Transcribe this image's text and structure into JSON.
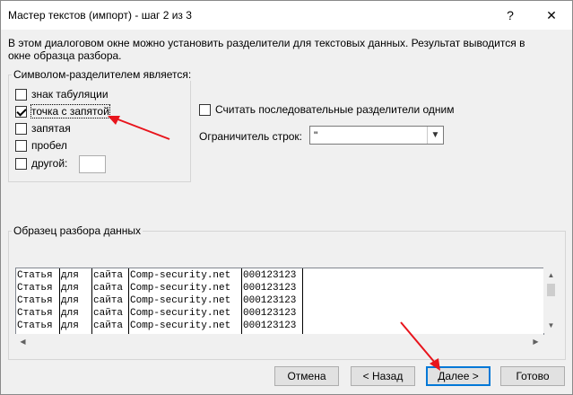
{
  "window": {
    "title": "Мастер текстов (импорт) - шаг 2 из 3",
    "help_label": "?",
    "close_label": "✕"
  },
  "intro": "В этом диалоговом окне можно установить разделители для текстовых данных. Результат выводится в окне образца разбора.",
  "delimiters": {
    "group_label": "Символом-разделителем является:",
    "tab": {
      "label": "знак табуляции",
      "checked": false
    },
    "semicolon": {
      "label": "точка с запятой",
      "checked": true
    },
    "comma": {
      "label": "запятая",
      "checked": false
    },
    "space": {
      "label": "пробел",
      "checked": false
    },
    "other": {
      "label": "другой:",
      "checked": false,
      "value": ""
    }
  },
  "consecutive": {
    "label": "Считать последовательные разделители одним",
    "checked": false
  },
  "qualifier": {
    "label": "Ограничитель строк:",
    "value": "\""
  },
  "preview": {
    "group_label": "Образец разбора данных",
    "rows": [
      [
        "Статья",
        "для",
        "сайта",
        "Comp-security.net",
        "000123123"
      ],
      [
        "Статья",
        "для",
        "сайта",
        "Comp-security.net",
        "000123123"
      ],
      [
        "Статья",
        "для",
        "сайта",
        "Comp-security.net",
        "000123123"
      ],
      [
        "Статья",
        "для",
        "сайта",
        "Comp-security.net",
        "000123123"
      ],
      [
        "Статья",
        "для",
        "сайта",
        "Comp-security.net",
        "000123123"
      ]
    ]
  },
  "buttons": {
    "cancel": "Отмена",
    "back": "< Назад",
    "next": "Далее >",
    "finish": "Готово"
  },
  "colors": {
    "annotation_arrow": "#e8141c",
    "focus_border": "#0078d7"
  }
}
